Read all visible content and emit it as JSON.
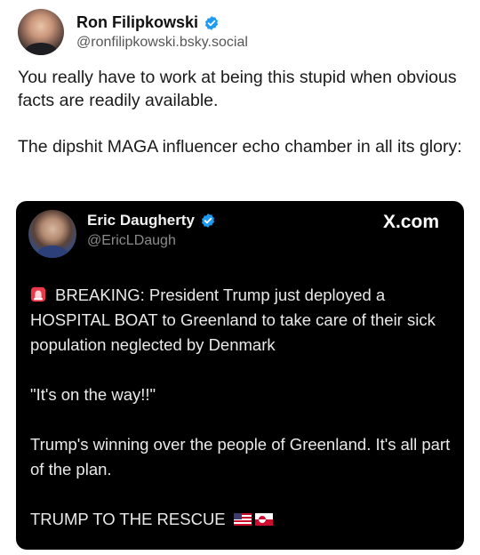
{
  "post": {
    "author_name": "Ron Filipkowski",
    "author_handle": "@ronfilipkowski.bsky.social",
    "paragraphs": [
      "You really have to work at being this stupid when obvious facts are readily available.",
      "The dipshit MAGA influencer echo chamber in all its glory:"
    ]
  },
  "embed": {
    "author_name": "Eric Daugherty",
    "author_handle": "@EricLDaugh",
    "source_label": "X.com",
    "paragraph_1": "BREAKING: President Trump just deployed a HOSPITAL BOAT to Greenland to take care of their sick population neglected by Denmark",
    "paragraph_2": "\"It's on the way!!\"",
    "paragraph_3": "Trump's winning over the people of Greenland. It's all part of the plan.",
    "paragraph_4": "TRUMP TO THE RESCUE"
  },
  "colors": {
    "verified": "#1d9bf0",
    "embed_bg": "#000000"
  },
  "icons": [
    "verified-badge-icon",
    "siren-icon",
    "us-flag-icon",
    "greenland-flag-icon"
  ]
}
